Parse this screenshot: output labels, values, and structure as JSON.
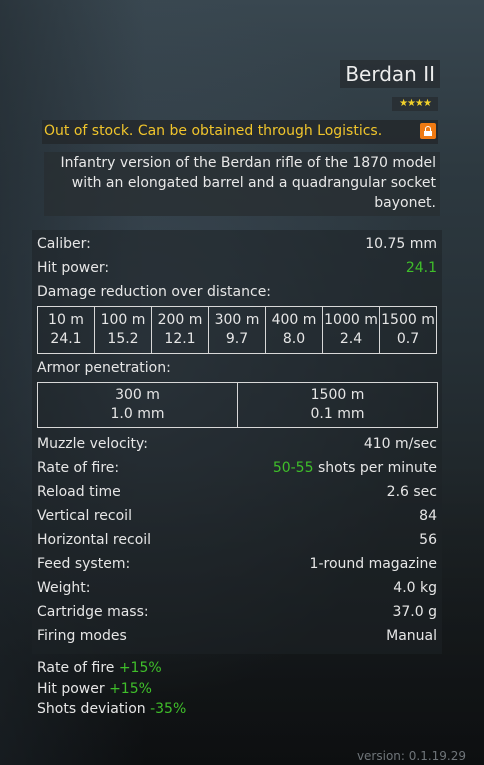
{
  "item": {
    "name": "Berdan II",
    "stars": "★★★★",
    "stock_notice": "Out of stock. Can be obtained through Logistics.",
    "description_lines": [
      "Infantry version of the Berdan rifle of the 1870 model",
      "with an elongated barrel and a quadrangular socket",
      "bayonet."
    ]
  },
  "stats": {
    "caliber_label": "Caliber:",
    "caliber_value": "10.75 mm",
    "hit_power_label": "Hit power:",
    "hit_power_value": "24.1",
    "damage_label": "Damage reduction over distance:",
    "damage_table": [
      {
        "distance": "10 m",
        "damage": "24.1"
      },
      {
        "distance": "100 m",
        "damage": "15.2"
      },
      {
        "distance": "200 m",
        "damage": "12.1"
      },
      {
        "distance": "300 m",
        "damage": "9.7"
      },
      {
        "distance": "400 m",
        "damage": "8.0"
      },
      {
        "distance": "1000 m",
        "damage": "2.4"
      },
      {
        "distance": "1500 m",
        "damage": "0.7"
      }
    ],
    "armor_label": "Armor penetration:",
    "armor_table": [
      {
        "distance": "300 m",
        "value": "1.0 mm"
      },
      {
        "distance": "1500 m",
        "value": "0.1 mm"
      }
    ],
    "muzzle_label": "Muzzle velocity:",
    "muzzle_value": "410 m/sec",
    "rof_label": "Rate of fire:",
    "rof_range": "50-55",
    "rof_unit": " shots per minute",
    "reload_label": "Reload time",
    "reload_value": "2.6 sec",
    "vrecoil_label": "Vertical recoil",
    "vrecoil_value": "84",
    "hrecoil_label": "Horizontal recoil",
    "hrecoil_value": "56",
    "feed_label": "Feed system:",
    "feed_value": "1-round magazine",
    "weight_label": "Weight:",
    "weight_value": "4.0 kg",
    "cart_label": "Cartridge mass:",
    "cart_value": "37.0 g",
    "modes_label": "Firing modes",
    "modes_value": "Manual"
  },
  "bonuses": [
    {
      "label": "Rate of fire ",
      "value": "+15%"
    },
    {
      "label": "Hit power ",
      "value": "+15%"
    },
    {
      "label": "Shots deviation ",
      "value": "-35%"
    }
  ],
  "version": "version: 0.1.19.29",
  "colors": {
    "accent_green": "#3fbf2a",
    "notice_yellow": "#f0c52c",
    "lock_orange": "#f07a12",
    "star_yellow": "#f1d12b"
  },
  "icons": {
    "lock": "lock-icon"
  }
}
